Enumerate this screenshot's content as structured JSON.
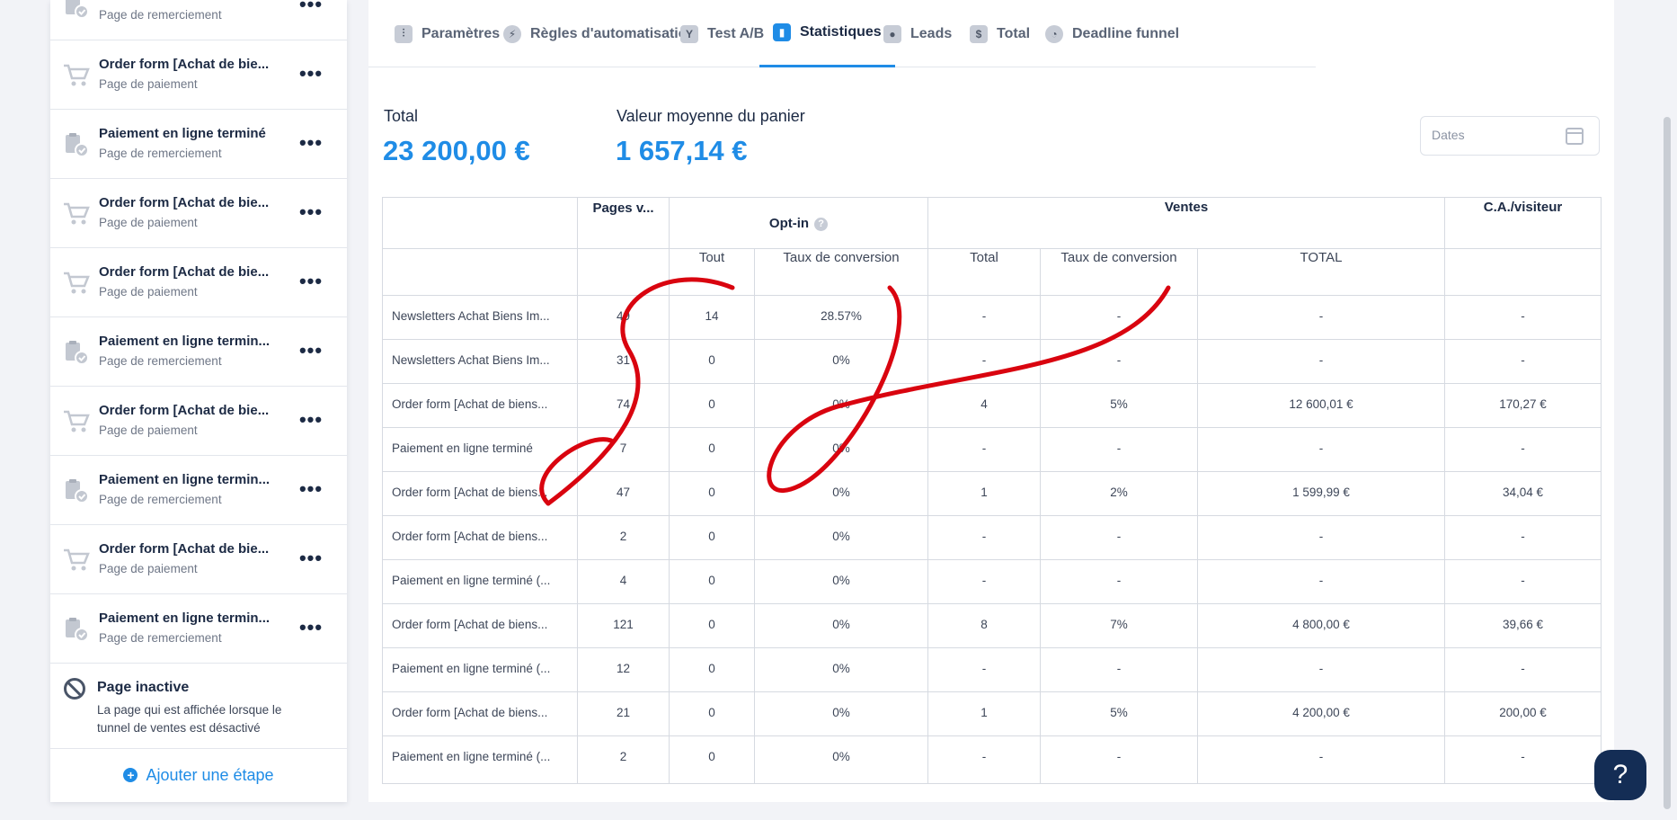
{
  "sidebar": {
    "steps": [
      {
        "title": "",
        "subtitle": "Page de remerciement",
        "icon": "clipboard-check-icon"
      },
      {
        "title": "Order form [Achat de bie...",
        "subtitle": "Page de paiement",
        "icon": "cart-icon"
      },
      {
        "title": "Paiement en ligne terminé",
        "subtitle": "Page de remerciement",
        "icon": "clipboard-check-icon"
      },
      {
        "title": "Order form [Achat de bie...",
        "subtitle": "Page de paiement",
        "icon": "cart-icon"
      },
      {
        "title": "Order form [Achat de bie...",
        "subtitle": "Page de paiement",
        "icon": "cart-icon"
      },
      {
        "title": "Paiement en ligne termin...",
        "subtitle": "Page de remerciement",
        "icon": "clipboard-check-icon"
      },
      {
        "title": "Order form [Achat de bie...",
        "subtitle": "Page de paiement",
        "icon": "cart-icon"
      },
      {
        "title": "Paiement en ligne termin...",
        "subtitle": "Page de remerciement",
        "icon": "clipboard-check-icon"
      },
      {
        "title": "Order form [Achat de bie...",
        "subtitle": "Page de paiement",
        "icon": "cart-icon"
      },
      {
        "title": "Paiement en ligne termin...",
        "subtitle": "Page de remerciement",
        "icon": "clipboard-check-icon"
      }
    ],
    "more_label": "•••",
    "inactive": {
      "title": "Page inactive",
      "description": "La page qui est affichée lorsque le tunnel de ventes est désactivé"
    },
    "add_step_label": "Ajouter une étape"
  },
  "tabs": [
    {
      "label": "Paramètres",
      "icon": "sliders-icon",
      "active": false
    },
    {
      "label": "Règles d'automatisation",
      "icon": "lightning-icon",
      "active": false
    },
    {
      "label": "Test A/B",
      "icon": "split-icon",
      "active": false
    },
    {
      "label": "Statistiques",
      "icon": "bar-chart-icon",
      "active": true
    },
    {
      "label": "Leads",
      "icon": "users-icon",
      "active": false
    },
    {
      "label": "Total",
      "icon": "dollar-icon",
      "active": false
    },
    {
      "label": "Deadline funnel",
      "icon": "clock-icon",
      "active": false
    }
  ],
  "summary": {
    "total_label": "Total",
    "total_value": "23 200,00 €",
    "avg_label": "Valeur moyenne du panier",
    "avg_value": "1 657,14 €"
  },
  "dates": {
    "placeholder": "Dates"
  },
  "table": {
    "group_headers": {
      "pages": "Pages v...",
      "optin": "Opt-in",
      "ventes": "Ventes",
      "ca": "C.A./visiteur"
    },
    "sub_headers": {
      "optin_all": "Tout",
      "optin_rate": "Taux de conversion",
      "ventes_total": "Total",
      "ventes_rate": "Taux de conversion",
      "ventes_amount": "TOTAL"
    },
    "rows": [
      {
        "name": "Newsletters Achat Biens Im...",
        "views": "49",
        "optin": "14",
        "optin_rate": "28.57%",
        "sales": "-",
        "sales_rate": "-",
        "amount": "-",
        "ca": "-"
      },
      {
        "name": "Newsletters Achat Biens Im...",
        "views": "31",
        "optin": "0",
        "optin_rate": "0%",
        "sales": "-",
        "sales_rate": "-",
        "amount": "-",
        "ca": "-"
      },
      {
        "name": "Order form [Achat de biens...",
        "views": "74",
        "optin": "0",
        "optin_rate": "0%",
        "sales": "4",
        "sales_rate": "5%",
        "amount": "12 600,01 €",
        "ca": "170,27 €"
      },
      {
        "name": "Paiement en ligne terminé",
        "views": "7",
        "optin": "0",
        "optin_rate": "0%",
        "sales": "-",
        "sales_rate": "-",
        "amount": "-",
        "ca": "-"
      },
      {
        "name": "Order form [Achat de biens...",
        "views": "47",
        "optin": "0",
        "optin_rate": "0%",
        "sales": "1",
        "sales_rate": "2%",
        "amount": "1 599,99 €",
        "ca": "34,04 €"
      },
      {
        "name": "Order form [Achat de biens...",
        "views": "2",
        "optin": "0",
        "optin_rate": "0%",
        "sales": "-",
        "sales_rate": "-",
        "amount": "-",
        "ca": "-"
      },
      {
        "name": "Paiement en ligne terminé (...",
        "views": "4",
        "optin": "0",
        "optin_rate": "0%",
        "sales": "-",
        "sales_rate": "-",
        "amount": "-",
        "ca": "-"
      },
      {
        "name": "Order form [Achat de biens...",
        "views": "121",
        "optin": "0",
        "optin_rate": "0%",
        "sales": "8",
        "sales_rate": "7%",
        "amount": "4 800,00 €",
        "ca": "39,66 €"
      },
      {
        "name": "Paiement en ligne terminé (...",
        "views": "12",
        "optin": "0",
        "optin_rate": "0%",
        "sales": "-",
        "sales_rate": "-",
        "amount": "-",
        "ca": "-"
      },
      {
        "name": "Order form [Achat de biens...",
        "views": "21",
        "optin": "0",
        "optin_rate": "0%",
        "sales": "1",
        "sales_rate": "5%",
        "amount": "4 200,00 €",
        "ca": "200,00 €"
      },
      {
        "name": "Paiement en ligne terminé (...",
        "views": "2",
        "optin": "0",
        "optin_rate": "0%",
        "sales": "-",
        "sales_rate": "-",
        "amount": "-",
        "ca": "-"
      }
    ]
  },
  "watermark": {
    "text": "Serge David",
    "color": "#d9040f"
  },
  "help": {
    "label": "?"
  },
  "colors": {
    "accent": "#1f8ce6",
    "text": "#1c2a44",
    "help_bg": "#142d55"
  }
}
